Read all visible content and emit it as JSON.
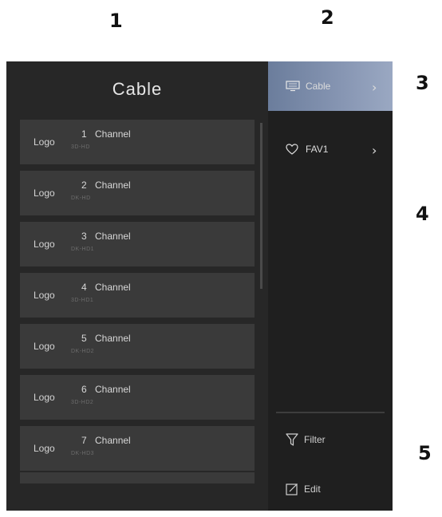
{
  "callouts": [
    "1",
    "2",
    "3",
    "4",
    "5"
  ],
  "list_title": "Cable",
  "channels": [
    {
      "logo": "Logo",
      "number": "1",
      "name": "Channel",
      "sub": "3D-HD"
    },
    {
      "logo": "Logo",
      "number": "2",
      "name": "Channel",
      "sub": "DK-HD"
    },
    {
      "logo": "Logo",
      "number": "3",
      "name": "Channel",
      "sub": "DK-HD1"
    },
    {
      "logo": "Logo",
      "number": "4",
      "name": "Channel",
      "sub": "3D-HD1"
    },
    {
      "logo": "Logo",
      "number": "5",
      "name": "Channel",
      "sub": "DK-HD2"
    },
    {
      "logo": "Logo",
      "number": "6",
      "name": "Channel",
      "sub": "3D-HD2"
    },
    {
      "logo": "Logo",
      "number": "7",
      "name": "Channel",
      "sub": "DK-HD3"
    }
  ],
  "sources": [
    {
      "label": "Cable",
      "icon": "tv-icon",
      "selected": true
    },
    {
      "label": "FAV1",
      "icon": "heart-icon",
      "selected": false
    }
  ],
  "actions": [
    {
      "label": "Filter",
      "icon": "filter-icon"
    },
    {
      "label": "Edit",
      "icon": "edit-icon"
    }
  ],
  "colors": {
    "panel_bg": "#272727",
    "sidebar_bg": "#1f1f1f",
    "row_bg": "#3a3a3a",
    "selected_bg": "#8796b3"
  }
}
